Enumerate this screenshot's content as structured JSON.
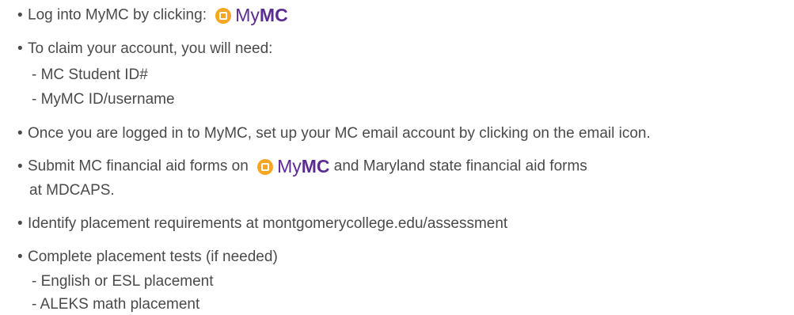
{
  "brand": {
    "logo_my": "My",
    "logo_mc": "MC",
    "color": "#5b2c91",
    "icon_color": "#f5a623"
  },
  "items": [
    {
      "text": "Log into MyMC by clicking:"
    },
    {
      "text": "To claim your account, you will need:",
      "subs": [
        "- MC Student ID#",
        "- MyMC ID/username"
      ]
    },
    {
      "text": "Once you are logged in to MyMC, set up your MC email account by clicking on the email icon."
    },
    {
      "text_before": "Submit MC financial aid forms on",
      "text_after": "and Maryland state financial aid forms",
      "continuation": "at MDCAPS."
    },
    {
      "text": "Identify placement requirements at montgomerycollege.edu/assessment"
    },
    {
      "text": "Complete placement tests (if needed)",
      "subs": [
        "- English or ESL placement",
        "- ALEKS math placement"
      ]
    }
  ]
}
